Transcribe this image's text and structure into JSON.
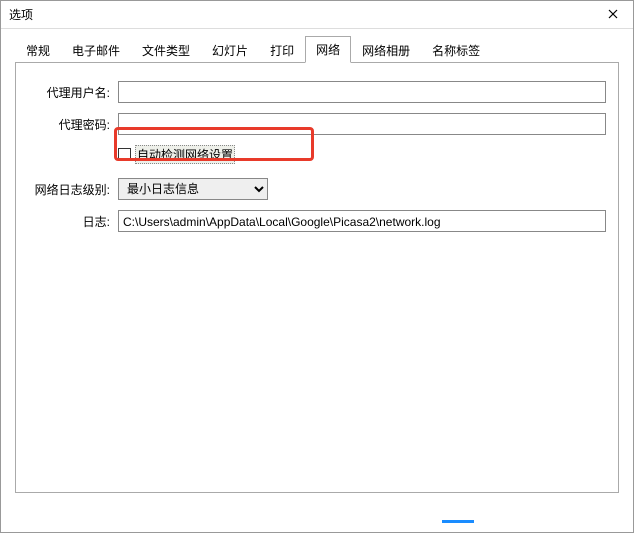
{
  "window": {
    "title": "选项"
  },
  "tabs": [
    {
      "label": "常规"
    },
    {
      "label": "电子邮件"
    },
    {
      "label": "文件类型"
    },
    {
      "label": "幻灯片"
    },
    {
      "label": "打印"
    },
    {
      "label": "网络"
    },
    {
      "label": "网络相册"
    },
    {
      "label": "名称标签"
    }
  ],
  "form": {
    "proxyUserLabel": "代理用户名:",
    "proxyUserValue": "",
    "proxyPassLabel": "代理密码:",
    "proxyPassValue": "",
    "autoDetectLabel": "自动检测网络设置",
    "logLevelLabel": "网络日志级别:",
    "logLevelSelected": "最小日志信息",
    "logLabel": "日志:",
    "logPath": "C:\\Users\\admin\\AppData\\Local\\Google\\Picasa2\\network.log"
  }
}
